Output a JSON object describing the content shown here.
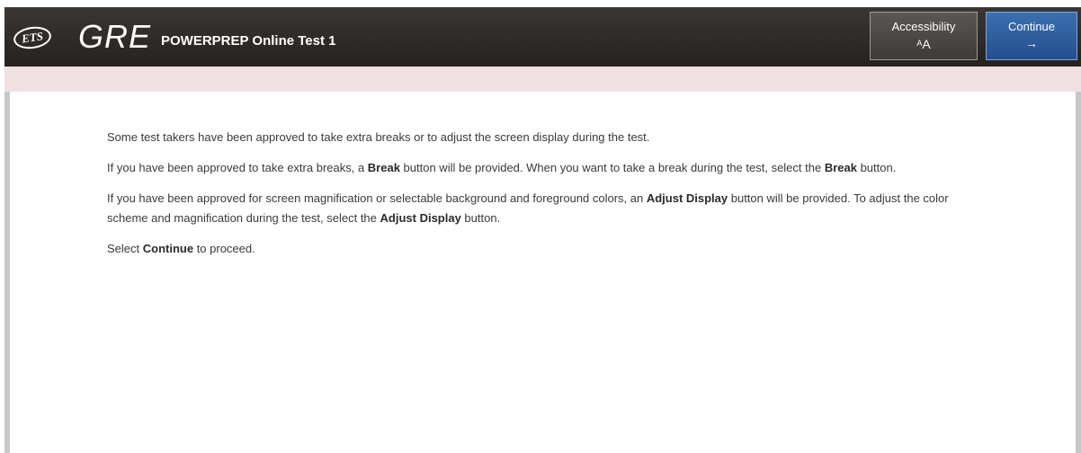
{
  "header": {
    "ets_logo": "ETS",
    "gre_logo": "GRE",
    "test_title": "POWERPREP Online Test 1",
    "accessibility_label": "Accessibility",
    "accessibility_icon_small": "A",
    "accessibility_icon_large": "A",
    "continue_label": "Continue",
    "continue_arrow": "→"
  },
  "content": {
    "p1": "Some test takers have been approved to take extra breaks or to adjust the screen display during the test.",
    "p2_a": "If you have been approved to take extra breaks, a ",
    "p2_bold1": "Break",
    "p2_b": " button will be provided. When you want to take a break during the test, select the ",
    "p2_bold2": "Break",
    "p2_c": " button.",
    "p3_a": "If you have been approved for screen magnification or selectable background and foreground colors, an ",
    "p3_bold1": "Adjust Display",
    "p3_b": " button will be provided. To adjust the color scheme and magnification during the test, select the ",
    "p3_bold2": "Adjust Display",
    "p3_c": " button.",
    "p4_a": "Select ",
    "p4_bold": "Continue",
    "p4_b": " to proceed."
  },
  "colors": {
    "topbar": "#2b2826",
    "continue_button": "#2f5f9f",
    "accent_strip": "#efe1e3"
  }
}
